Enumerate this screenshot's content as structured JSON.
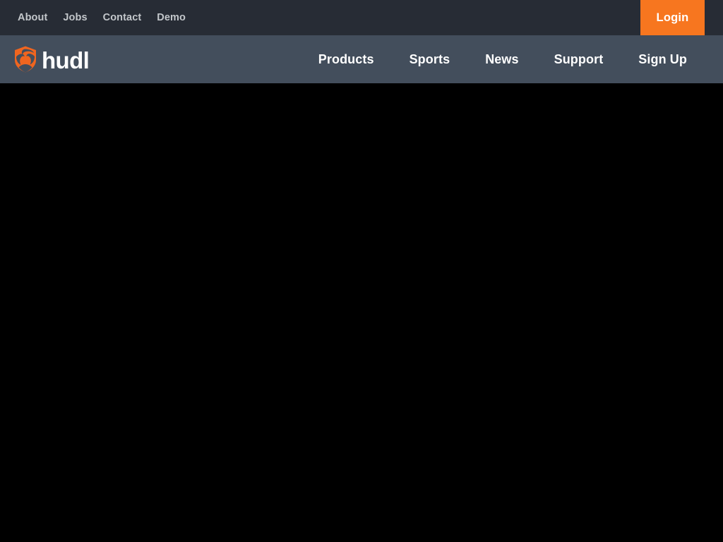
{
  "colors": {
    "utility_bar_bg": "#272C35",
    "main_nav_bg": "#434E5C",
    "accent_orange": "#F7761F",
    "utility_link_text": "#C3C7CB",
    "nav_link_text": "#FFFFFF",
    "content_bg": "#000000"
  },
  "utility_bar": {
    "links": [
      {
        "label": "About"
      },
      {
        "label": "Jobs"
      },
      {
        "label": "Contact"
      },
      {
        "label": "Demo"
      }
    ],
    "login_label": "Login"
  },
  "main_nav": {
    "brand": {
      "wordmark": "hudl",
      "mark_name": "hudl-shield-logo-icon"
    },
    "links": [
      {
        "label": "Products"
      },
      {
        "label": "Sports"
      },
      {
        "label": "News"
      },
      {
        "label": "Support"
      },
      {
        "label": "Sign Up"
      }
    ]
  },
  "content": {
    "text": ""
  }
}
